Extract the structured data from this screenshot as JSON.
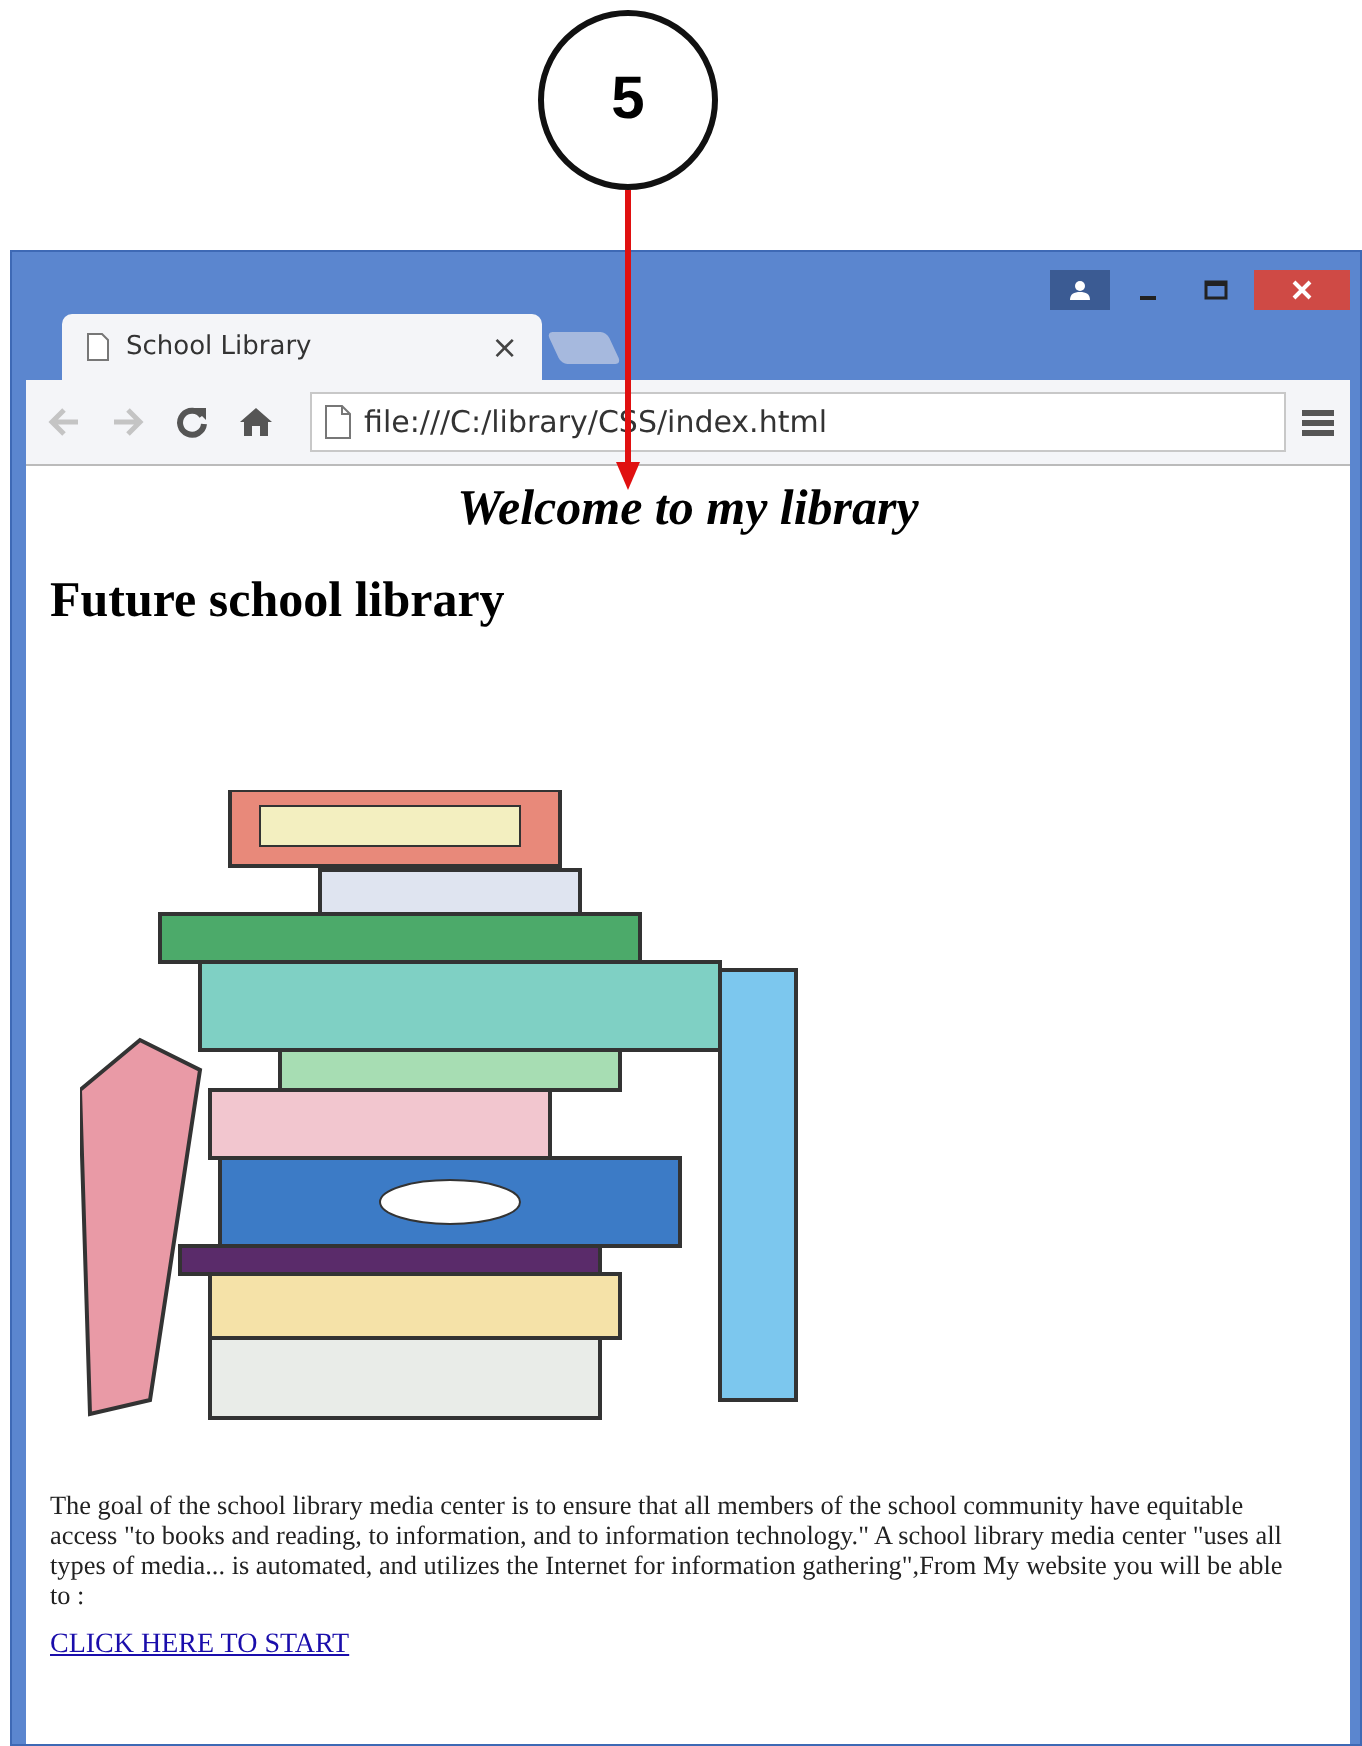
{
  "annotation": {
    "label": "5"
  },
  "tabs": [
    {
      "title": "School Library",
      "close": "×",
      "selected": true
    }
  ],
  "nav": [
    {
      "kind": "back",
      "disabled": true
    },
    {
      "kind": "forward",
      "disabled": true
    },
    {
      "kind": "reload",
      "disabled": false
    },
    {
      "kind": "home",
      "disabled": false
    }
  ],
  "address": {
    "value": "file:///C:/library/CSS/index.html"
  },
  "page": {
    "banner": "Welcome to my library",
    "heading": "Future school library",
    "paragraph": "The goal of the school library media center is to ensure that all members of the school community have equitable access \"to books and reading, to information, and to information technology.\" A school library media center \"uses all types of media... is automated, and utilizes the Internet for information gathering\",From My website you will be able to :",
    "link": "CLICK HERE TO START"
  }
}
